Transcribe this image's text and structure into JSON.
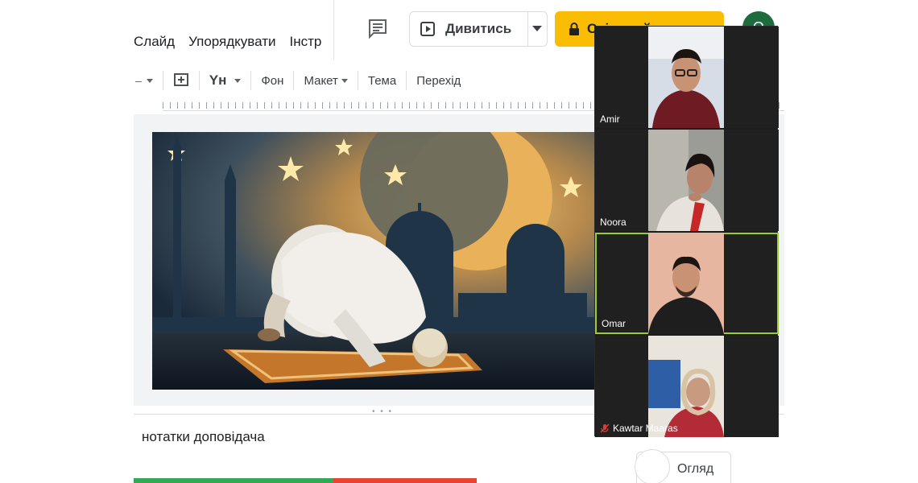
{
  "menu": {
    "items": [
      "Слайд",
      "Упорядкувати",
      "Інстр"
    ]
  },
  "header": {
    "slideshow_label": "Дивитись",
    "share_label": "Спільний доступ",
    "avatar_letter": "O"
  },
  "toolbar": {
    "text_tool": "Yн",
    "background": "Фон",
    "layout": "Макет",
    "theme": "Тема",
    "transition": "Перехід"
  },
  "notes": {
    "placeholder": "нотатки доповідача"
  },
  "explore": {
    "label": "Огляд"
  },
  "video_call": {
    "participants": [
      {
        "name": "Amir",
        "active": false,
        "muted": false
      },
      {
        "name": "Noora",
        "active": false,
        "muted": false
      },
      {
        "name": "Omar",
        "active": true,
        "muted": false
      },
      {
        "name": "Kawtar Maaras",
        "active": false,
        "muted": true
      }
    ]
  },
  "colors": {
    "share_accent": "#fbbc04",
    "active_speaker": "#9acd32",
    "avatar": "#1e6b3e",
    "muted_icon": "#e53935"
  }
}
